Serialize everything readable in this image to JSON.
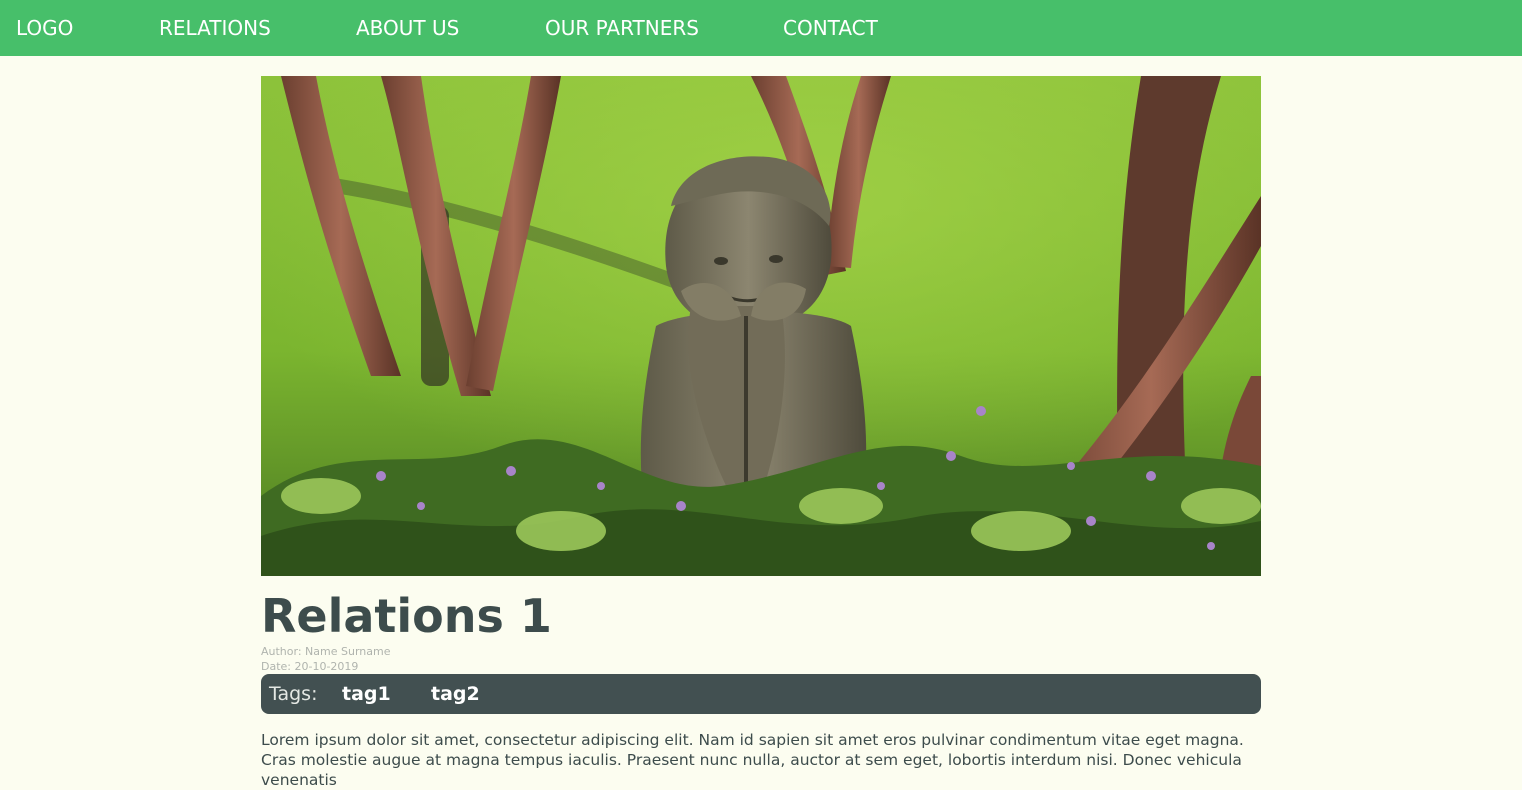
{
  "nav": {
    "logo": "LOGO",
    "relations": "RELATIONS",
    "about": "ABOUT US",
    "partners": "OUR PARTNERS",
    "contact": "CONTACT"
  },
  "post": {
    "title": "Relations 1",
    "author": "Author: Name Surname",
    "date": "Date: 20-10-2019",
    "tags_label": "Tags:",
    "tags": [
      "tag1",
      "tag2"
    ],
    "body": "Lorem ipsum dolor sit amet, consectetur adipiscing elit. Nam id sapien sit amet eros pulvinar condimentum vitae eget magna. Cras molestie augue at magna tempus iaculis. Praesent nunc nulla, auctor at sem eget, lobortis interdum nisi. Donec vehicula venenatis"
  },
  "hero": {
    "subject": "stone-child-statue-in-garden"
  },
  "colors": {
    "nav_bg": "#47bf6a",
    "page_bg": "#fcfdf0",
    "tags_bg": "#425051",
    "title": "#3d4c4c"
  }
}
